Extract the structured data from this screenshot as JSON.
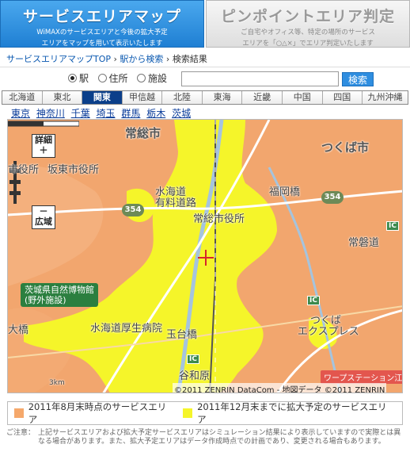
{
  "tabs": [
    {
      "title": "サービスエリアマップ",
      "subtitle1": "WiMAXのサービスエリアと今後の拡大予定",
      "subtitle2": "エリアをマップを用いて表示いたします"
    },
    {
      "title": "ピンポイントエリア判定",
      "subtitle1": "ご自宅やオフィス等、特定の場所のサービス",
      "subtitle2": "エリアを「○△×」でエリア判定いたします"
    }
  ],
  "breadcrumb": {
    "home": "サービスエリアマップTOP",
    "sep": "›",
    "station": "駅から検索",
    "current": "検索結果"
  },
  "search": {
    "options": [
      {
        "label": "駅",
        "checked": true
      },
      {
        "label": "住所",
        "checked": false
      },
      {
        "label": "施設",
        "checked": false
      }
    ],
    "value": "",
    "button": "検索"
  },
  "regions": [
    "北海道",
    "東北",
    "関東",
    "甲信越",
    "北陸",
    "東海",
    "近畿",
    "中国",
    "四国",
    "九州沖縄"
  ],
  "active_region": "関東",
  "prefectures": [
    "東京",
    "神奈川",
    "千葉",
    "埼玉",
    "群馬",
    "栃木",
    "茨城"
  ],
  "map": {
    "zoom_in": "詳細",
    "zoom_out": "広域",
    "labels": {
      "joso_city": "常総市",
      "tsukuba_city": "つくば市",
      "city_hall_left": "市役所",
      "bandou": "坂東市役所",
      "mizukaido": "水海道",
      "yuugai": "有料道路",
      "joso_hall": "常総市役所",
      "fukuoka_bridge": "福岡橋",
      "tsukuba_road": "常磐道",
      "tsukuba_express": "つくば",
      "express": "エクスプレス",
      "mizukaido_hs": "水海道厚生病院",
      "tamadai": "玉台橋",
      "yawahara": "谷和原",
      "ohashi": "大橋",
      "museum1": "茨城県自然博物館",
      "museum2": "(野外施設)",
      "station": "ワープステーション江戸",
      "route354_a": "354",
      "route354_b": "354",
      "ic_a": "IC",
      "ic_b": "IC",
      "ic_c": "IC",
      "scale": "3km",
      "copyright": "©2011 ZENRIN DataCom - 地図データ ©2011 ZENRIN"
    }
  },
  "legend": [
    {
      "label": "2011年8月末時点のサービスエリア",
      "color": "#f5a86b"
    },
    {
      "label": "2011年12月末までに拡大予定のサービスエリア",
      "color": "#f5f52a"
    }
  ],
  "note": {
    "label": "ご注意：",
    "text": "上記サービスエリアおよび拡大予定サービスエリアはシミュレーション結果により表示していますので実際とは異なる場合があります。また、拡大予定エリアはデータ作成時点での計画であり、変更される場合もあります。"
  }
}
